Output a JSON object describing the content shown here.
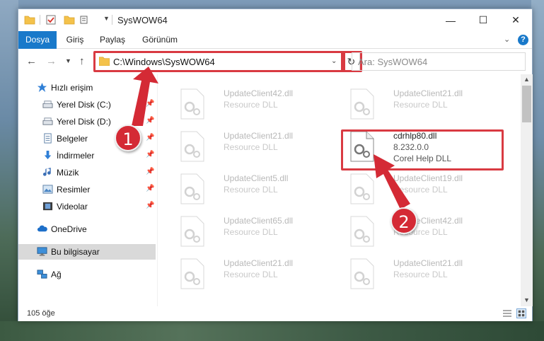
{
  "window": {
    "title": "SysWOW64",
    "controls": {
      "minimize": "—",
      "maximize": "☐",
      "close": "✕"
    }
  },
  "ribbon": {
    "tabs": [
      "Dosya",
      "Giriş",
      "Paylaş",
      "Görünüm"
    ],
    "help": "?"
  },
  "address_bar": {
    "path": "C:\\Windows\\SysWOW64",
    "search_placeholder": "Ara: SysWOW64"
  },
  "sidebar": {
    "items": [
      {
        "label": "Hızlı erişim",
        "icon": "star-icon",
        "pinned": false
      },
      {
        "label": "Yerel Disk (C:)",
        "icon": "drive-icon",
        "pinned": true
      },
      {
        "label": "Yerel Disk (D:)",
        "icon": "drive-icon",
        "pinned": true
      },
      {
        "label": "Belgeler",
        "icon": "documents-icon",
        "pinned": true
      },
      {
        "label": "İndirmeler",
        "icon": "download-icon",
        "pinned": true
      },
      {
        "label": "Müzik",
        "icon": "music-icon",
        "pinned": true
      },
      {
        "label": "Resimler",
        "icon": "pictures-icon",
        "pinned": true
      },
      {
        "label": "Videolar",
        "icon": "video-icon",
        "pinned": true
      },
      {
        "label": "OneDrive",
        "icon": "cloud-icon",
        "pinned": false
      },
      {
        "label": "Bu bilgisayar",
        "icon": "computer-icon",
        "pinned": false,
        "selected": true
      },
      {
        "label": "Ağ",
        "icon": "network-icon",
        "pinned": false
      }
    ]
  },
  "files": [
    {
      "name": "UpdateClient42.dll",
      "desc": "Resource DLL",
      "faded": true
    },
    {
      "name": "UpdateClient21.dll",
      "desc": "Resource DLL",
      "faded": true
    },
    {
      "name": "UpdateClient21.dll",
      "desc": "Resource DLL",
      "faded": true
    },
    {
      "name": "cdrhlp80.dll",
      "version": "8.232.0.0",
      "desc": "Corel Help DLL",
      "faded": false,
      "highlighted": true
    },
    {
      "name": "UpdateClient5.dll",
      "desc": "Resource DLL",
      "faded": true
    },
    {
      "name": "UpdateClient19.dll",
      "desc": "Resource DLL",
      "faded": true
    },
    {
      "name": "UpdateClient65.dll",
      "desc": "Resource DLL",
      "faded": true
    },
    {
      "name": "UpdateClient42.dll",
      "desc": "Resource DLL",
      "faded": true
    },
    {
      "name": "UpdateClient21.dll",
      "desc": "Resource DLL",
      "faded": true
    },
    {
      "name": "UpdateClient21.dll",
      "desc": "Resource DLL",
      "faded": true
    }
  ],
  "status": {
    "count": "105 öğe"
  },
  "annotations": {
    "badge_1": "1",
    "badge_2": "2",
    "color": "#d42a35"
  },
  "colors": {
    "accent": "#1979ca",
    "highlight": "#d93a42"
  }
}
